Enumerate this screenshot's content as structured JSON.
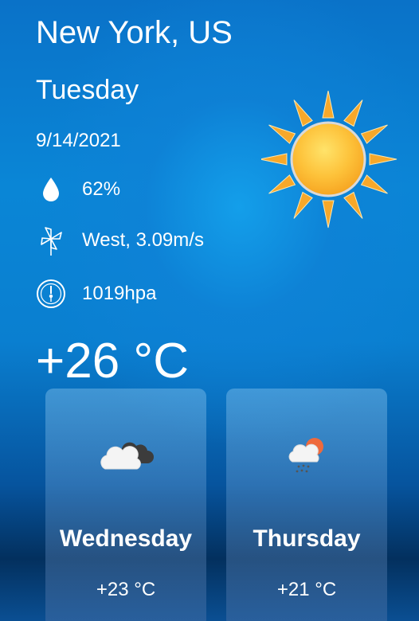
{
  "location": "New York, US",
  "day": "Tuesday",
  "date": "9/14/2021",
  "humidity": "62%",
  "wind": "West, 3.09m/s",
  "pressure": "1019hpa",
  "temperature": "+26 °C",
  "current_icon": "sun-icon",
  "forecast": [
    {
      "day": "Wednesday",
      "temp": "+23 °C",
      "icon": "cloudy-icon"
    },
    {
      "day": "Thursday",
      "temp": "+21 °C",
      "icon": "sun-rain-cloud-icon"
    }
  ],
  "colors": {
    "background": "#0a86d6",
    "text": "#ffffff",
    "sun": "#fbb92f"
  }
}
